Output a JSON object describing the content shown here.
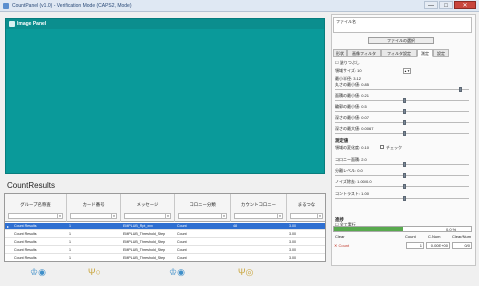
{
  "window": {
    "title": "CountPanel (v1.0) - Verification Mode (CAPS2, Mode)",
    "min_glyph": "—",
    "max_glyph": "□",
    "close_glyph": "✕"
  },
  "image_panel": {
    "title": "Image Panel"
  },
  "results": {
    "title": "CountResults",
    "columns": [
      "グループ名称査",
      "カード番号",
      "メッセージ",
      "コロニー分類",
      "カウントコロニー",
      "まるつな"
    ],
    "filter_arrow": "▾",
    "row_marker": "▸",
    "rows": [
      [
        "Count Results",
        "1",
        "EMPLUB_Rpt_xxx",
        "Count",
        "48",
        "3.00"
      ],
      [
        "Count Results",
        "1",
        "EMPLUB_Threshold_Step",
        "Count",
        "",
        "3.00"
      ],
      [
        "Count Results",
        "1",
        "EMPLUB_Threshold_Step",
        "Count",
        "",
        "3.00"
      ],
      [
        "Count Results",
        "1",
        "EMPLUB_Threshold_Step",
        "Count",
        "",
        "3.00"
      ],
      [
        "Count Results",
        "1",
        "EMPLUB_Threshold_Step",
        "Count",
        "",
        "3.00"
      ]
    ]
  },
  "bottom_icons": [
    "♔◉",
    "Ψ○",
    "♔◉",
    "Ψ◎"
  ],
  "right_panel": {
    "top_text": "ファイル名",
    "button_label": "ファイルの選択",
    "tabs": [
      "形状",
      "画像フィルタ",
      "フィルタ設定",
      "測定",
      "設定"
    ],
    "active_tab": 3,
    "params": [
      {
        "label": "☐ 塗りつぶし"
      },
      {
        "label": "領域サイズ: 10",
        "spin": "▲▼"
      },
      {
        "label": "最小半径: 3.12"
      },
      {
        "label": "丸さの最小値: 0.85"
      },
      {
        "label": "面積の最小値: 0.21"
      },
      {
        "label": "輪郭の最小値: 0.5"
      },
      {
        "label": "深さの最小値: 0.07"
      },
      {
        "label": "深さの最大値: 0.0067"
      }
    ],
    "section_label": "測定値",
    "section_rows": [
      {
        "label": "領域の変化度: 0.10",
        "check_label": "チェック"
      },
      {
        "label": "コロニー面積: 2.0"
      },
      {
        "label": "分離レベル: 0.0"
      },
      {
        "label": "ノイズ除去: 1.00/0.0"
      },
      {
        "label": "コントラスト: 1.00"
      }
    ],
    "progress": {
      "label": "進捗",
      "value_text": "0.0 %",
      "fraction": 0.5
    },
    "count_header": [
      "Count",
      "C.Num",
      "Clear/Num"
    ],
    "count_row": {
      "marker": "✕ Count",
      "values": [
        "1",
        "0.00E+00",
        "0/0"
      ]
    },
    "process_label": "☐ 全て実行",
    "clear_label": "Clear"
  }
}
